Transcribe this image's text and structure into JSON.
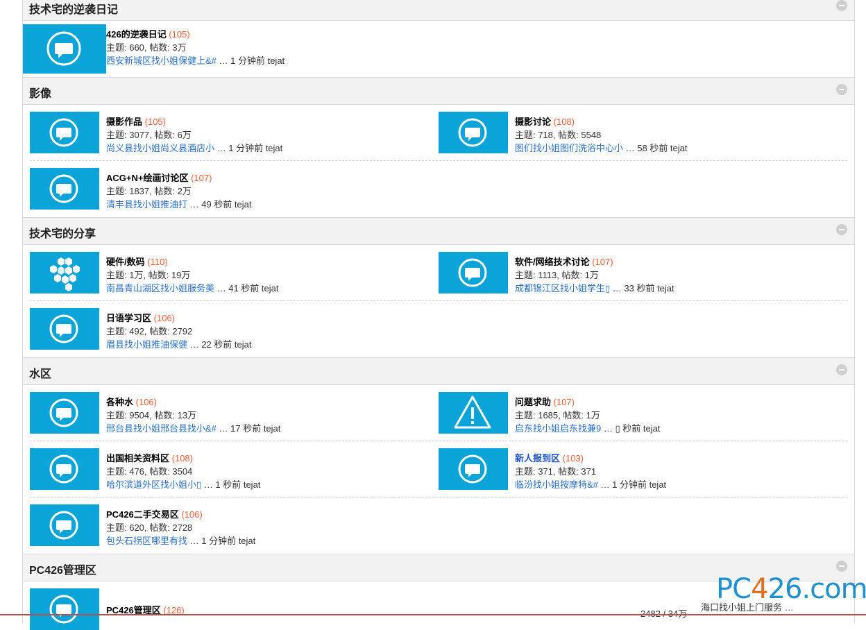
{
  "categories": [
    {
      "title": "技术宅的逆袭日记"
    },
    {
      "title": "影像"
    },
    {
      "title": "技术宅的分享"
    },
    {
      "title": "水区"
    },
    {
      "title": "PC426管理区"
    }
  ],
  "forums": {
    "f0": {
      "name": "426的逆袭日记",
      "count": "(105)",
      "stats": "主题: 660, 帖数: 3万",
      "thread": "西安新城区找小姐保健上&#",
      "last": " … 1 分钟前 tejat",
      "icon": "chat-bubble-icon"
    },
    "f1": {
      "name": "摄影作品",
      "count": "(105)",
      "stats": "主题: 3077, 帖数: 6万",
      "thread": "尚义县找小姐尚义县酒店小",
      "last": " … 1 分钟前 tejat",
      "icon": "chat-bubble-icon"
    },
    "f2": {
      "name": "摄影讨论",
      "count": "(108)",
      "stats": "主题: 718, 帖数: 5548",
      "thread": "图们找小姐图们洗浴中心小",
      "last": " … 58 秒前 tejat",
      "icon": "chat-bubble-icon"
    },
    "f3": {
      "name": "ACG+N+绘画讨论区",
      "count": "(107)",
      "stats": "主题: 1837, 帖数: 2万",
      "thread": "清丰县找小姐推油打",
      "last": " … 49 秒前 tejat",
      "icon": "chat-bubble-icon"
    },
    "f4": {
      "name": "硬件/数码",
      "count": "(110)",
      "stats": "主题: 1万, 帖数: 19万",
      "thread": "南昌青山湖区找小姐服务美",
      "last": " … 41 秒前 tejat",
      "icon": "hexagon-cluster-icon"
    },
    "f5": {
      "name": "软件/网络技术讨论",
      "count": "(107)",
      "stats": "主题: 1113, 帖数: 1万",
      "thread": "成都锦江区找小姐学生▯",
      "last": " … 33 秒前 tejat",
      "icon": "chat-bubble-icon"
    },
    "f6": {
      "name": "日语学习区",
      "count": "(106)",
      "stats": "主题: 492, 帖数: 2792",
      "thread": "眉县找小姐推油保健",
      "last": " … 22 秒前 tejat",
      "icon": "chat-bubble-icon"
    },
    "f7": {
      "name": "各种水",
      "count": "(106)",
      "stats": "主题: 9504, 帖数: 13万",
      "thread": "邢台县找小姐邢台县找小&#",
      "last": " … 17 秒前 tejat",
      "icon": "chat-bubble-icon"
    },
    "f8": {
      "name": "问题求助",
      "count": "(107)",
      "stats": "主题: 1685, 帖数: 1万",
      "thread": "启东找小姐启东找兼9",
      "last": " … ▯ 秒前 tejat",
      "icon": "warning-triangle-icon"
    },
    "f9": {
      "name": "出国相关资料区",
      "count": "(108)",
      "stats": "主题: 476, 帖数: 3504",
      "thread": "哈尔滨道外区找小姐小▯",
      "last": " … 1 秒前 tejat",
      "icon": "chat-bubble-icon"
    },
    "f10": {
      "name": "新人报到区",
      "count": "(103)",
      "stats": "主题: 371, 帖数: 371",
      "thread": "临汾找小姐按摩特&#",
      "last": " … 1 分钟前 tejat",
      "icon": "chat-bubble-icon"
    },
    "f11": {
      "name": "PC426二手交易区",
      "count": "(106)",
      "stats": "主题: 620, 帖数: 2728",
      "thread": "包头石拐区哪里有找",
      "last": " … 1 分钟前 tejat",
      "icon": "chat-bubble-icon"
    },
    "f12": {
      "name": "PC426管理区",
      "count": "(126)",
      "icon": "chat-bubble-icon"
    }
  },
  "extra": {
    "stats_partial": "2482 / 34万",
    "thread_partial": "海口找小姐上门服务 …"
  },
  "watermark": {
    "text_a": "PC",
    "text_o": "4",
    "text_b": "26.com"
  },
  "colors": {
    "icon_bg": "#0aa4d9",
    "count": "#e8603c",
    "link": "#2a6fc4",
    "highlight_name": "#1a4fc9"
  }
}
